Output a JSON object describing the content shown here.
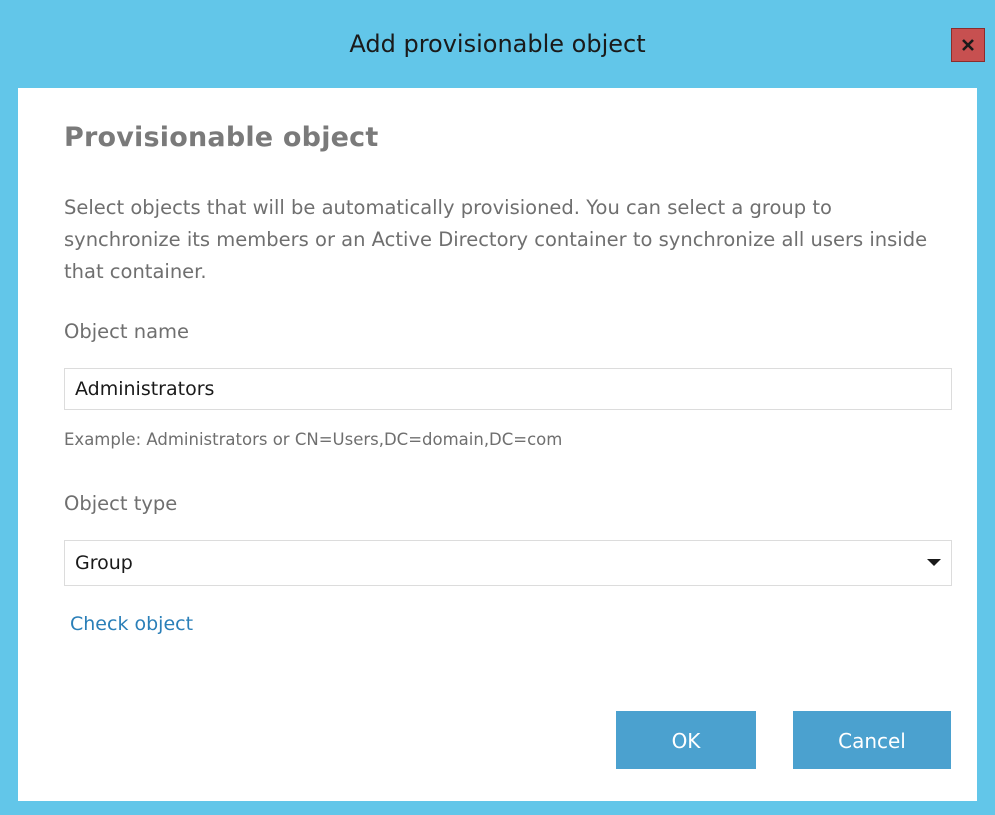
{
  "window": {
    "title": "Add provisionable object",
    "close_label": "x"
  },
  "content": {
    "heading": "Provisionable object",
    "description": "Select objects that will be automatically provisioned. You can select a group to synchronize its members or an Active Directory container to synchronize all users inside that container.",
    "object_name_label": "Object name",
    "object_name_value": "Administrators",
    "object_name_hint": "Example: Administrators or CN=Users,DC=domain,DC=com",
    "object_type_label": "Object type",
    "object_type_value": "Group",
    "check_object_link": "Check object"
  },
  "buttons": {
    "ok_label": "OK",
    "cancel_label": "Cancel"
  },
  "colors": {
    "title_bar": "#62c6e9",
    "close_button": "#c75050",
    "primary_button": "#4ba1cf",
    "link": "#2a7fb8"
  }
}
